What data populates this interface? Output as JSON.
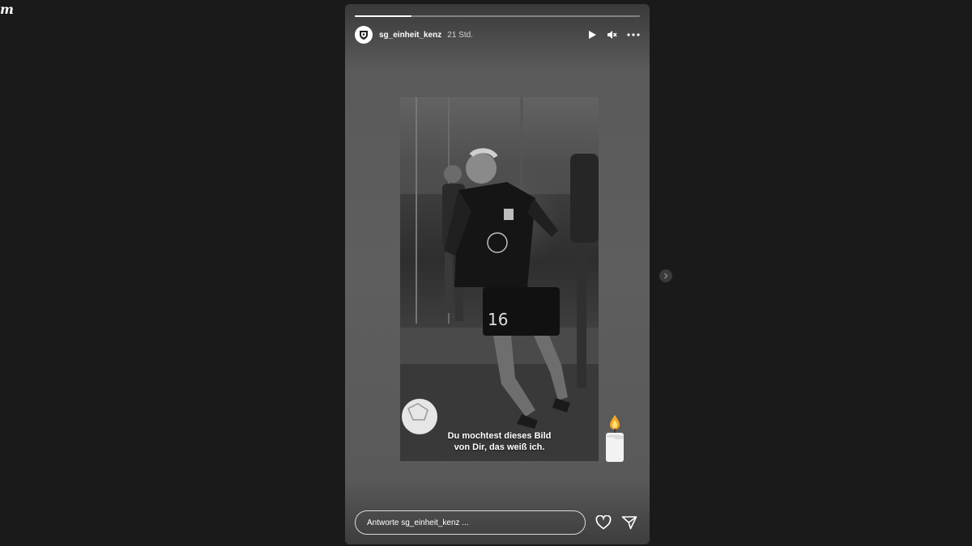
{
  "page": {
    "logo_fragment": "m"
  },
  "story": {
    "progress": 0.2,
    "username": "sg_einheit_kenz",
    "time_ago": "21 Std.",
    "caption_line1": "Du mochtest dieses Bild",
    "caption_line2": "von Dir, das weiß ich.",
    "jersey_number": "16",
    "reply_placeholder": "Antworte sg_einheit_kenz ...",
    "icons": {
      "play": "play-icon",
      "mute": "mute-icon",
      "more": "more-icon",
      "like": "heart-icon",
      "share": "send-icon",
      "next": "chevron-right-icon",
      "sticker": "candle-icon"
    }
  },
  "colors": {
    "background": "#1a1a1a",
    "story_bg": "#5e5e5e",
    "text": "#ffffff"
  }
}
